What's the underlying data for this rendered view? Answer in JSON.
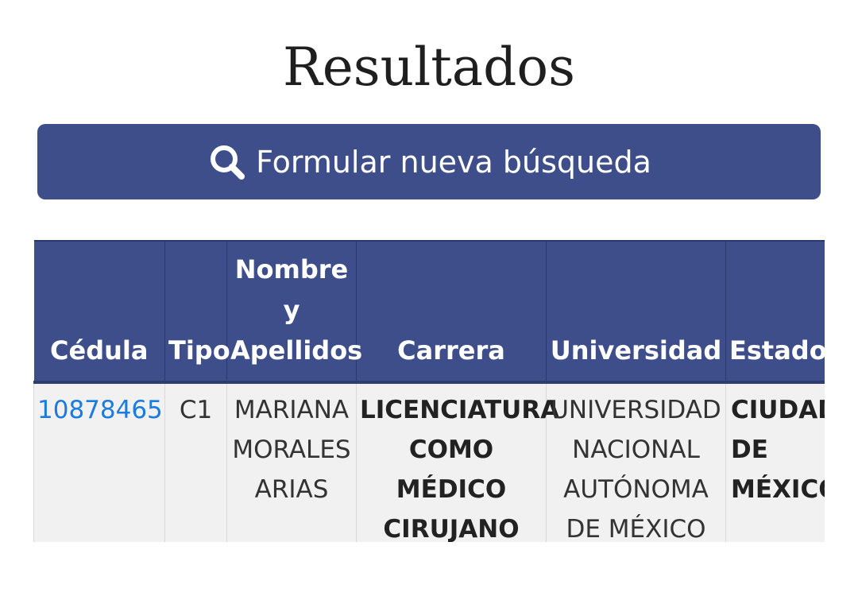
{
  "page": {
    "title": "Resultados"
  },
  "search_button": {
    "label": "Formular nueva búsqueda",
    "icon": "search-icon"
  },
  "table": {
    "headers": [
      "Cédula",
      "Tipo",
      "Nombre y Apellidos",
      "Carrera",
      "Universidad",
      "Estado"
    ],
    "rows": [
      {
        "cedula": "10878465",
        "tipo": "C1",
        "nombre": "MARIANA MORALES ARIAS",
        "carrera": "LICENCIATURA COMO MÉDICO CIRUJANO",
        "universidad": "UNIVERSIDAD NACIONAL AUTÓNOMA DE MÉXICO",
        "estado": "CIUDAD DE MÉXICO"
      }
    ]
  },
  "colors": {
    "primary": "#3d4e8a",
    "link": "#1a7be0",
    "row_bg": "#f1f1f1"
  }
}
